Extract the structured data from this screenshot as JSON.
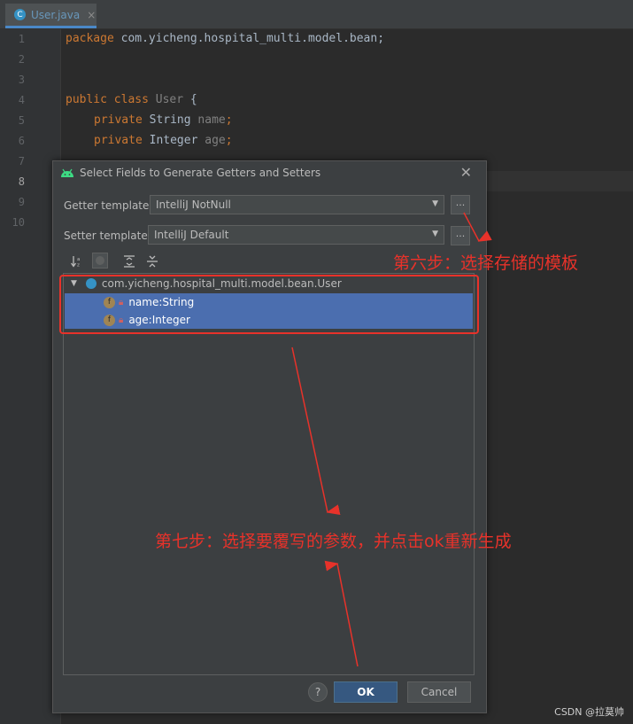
{
  "editor": {
    "tab_title": "User.java",
    "tab_close": "×",
    "tab_icon_letter": "C",
    "line_numbers": [
      "1",
      "2",
      "3",
      "4",
      "5",
      "6",
      "7",
      "8",
      "9",
      "10"
    ],
    "code": {
      "line1_kw": "package",
      "line1_rest": " com.yicheng.hospital_multi.model.bean;",
      "line4_kw": "public class",
      "line4_name": " User",
      "line4_rest": " {",
      "line5_kw": "private",
      "line5_type": " String",
      "line5_field": " name",
      "line5_end": ";",
      "line6_kw": "private",
      "line6_type": " Integer",
      "line6_field": " age",
      "line6_end": ";"
    }
  },
  "dialog": {
    "title": "Select Fields to Generate Getters and Setters",
    "close": "✕",
    "getter_label": "Getter template:",
    "getter_value": "IntelliJ NotNull",
    "setter_label": "Setter template:",
    "setter_value": "IntelliJ Default",
    "dots_label": "...",
    "tree_root": "com.yicheng.hospital_multi.model.bean.User",
    "fields": [
      {
        "name": "name:String",
        "icon": "f"
      },
      {
        "name": "age:Integer",
        "icon": "f"
      }
    ],
    "help_label": "?",
    "ok_label": "OK",
    "cancel_label": "Cancel"
  },
  "annotations": {
    "step6": "第六步：选择存储的模板",
    "step7": "第七步：选择要覆写的参数，并点击ok重新生成"
  },
  "watermark": "CSDN @拉莫帅",
  "colors": {
    "annotation_red": "#e8322a",
    "selection_blue": "#4b6eaf",
    "ok_button": "#365880"
  }
}
